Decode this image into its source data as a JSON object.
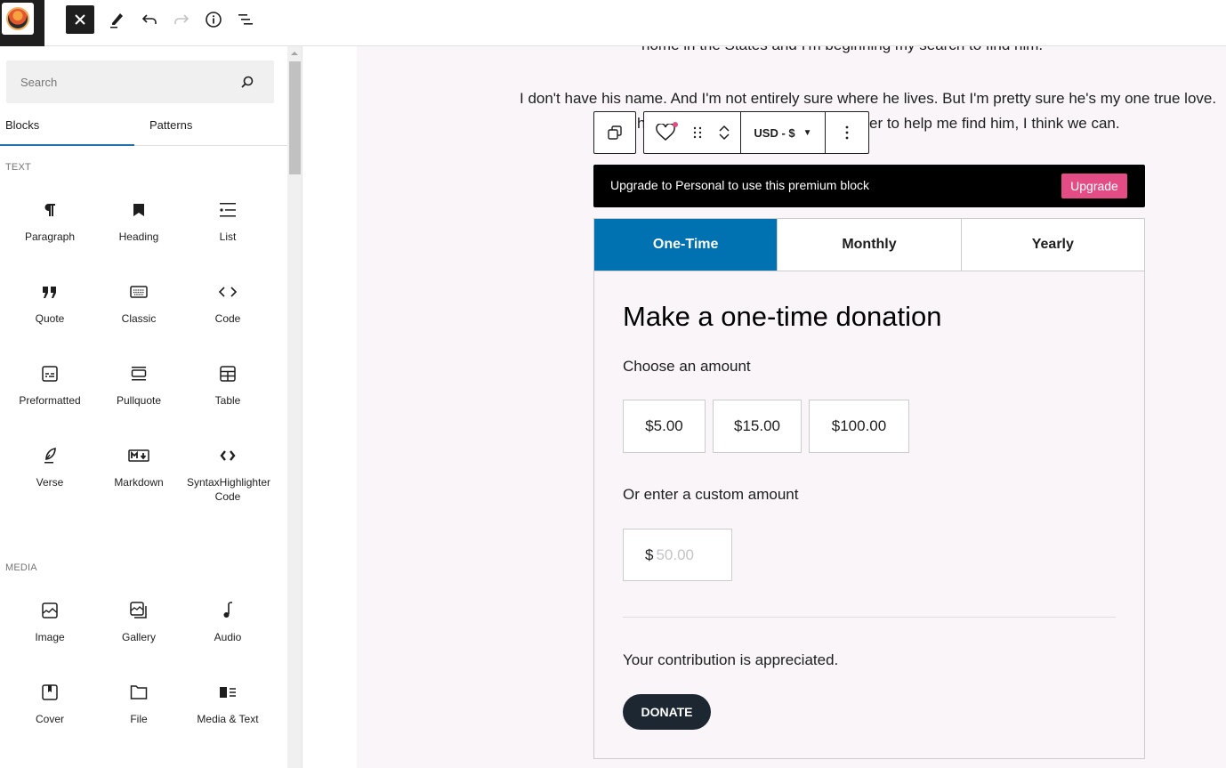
{
  "topbar": {
    "logo_alt": "site-logo",
    "buttons": [
      {
        "name": "close-inserter",
        "icon": "close-icon",
        "glyph": "✕"
      },
      {
        "name": "tools",
        "icon": "pencil-icon"
      },
      {
        "name": "undo",
        "icon": "undo-icon"
      },
      {
        "name": "redo",
        "icon": "redo-icon",
        "disabled": true
      },
      {
        "name": "details",
        "icon": "info-icon"
      },
      {
        "name": "list-view",
        "icon": "list-view-icon"
      }
    ]
  },
  "sidebar": {
    "search_placeholder": "Search",
    "tabs": [
      {
        "label": "Blocks",
        "active": true
      },
      {
        "label": "Patterns",
        "active": false
      }
    ],
    "categories": [
      {
        "title": "TEXT",
        "blocks": [
          {
            "label": "Paragraph",
            "icon": "paragraph-icon"
          },
          {
            "label": "Heading",
            "icon": "heading-icon"
          },
          {
            "label": "List",
            "icon": "list-icon"
          },
          {
            "label": "Quote",
            "icon": "quote-icon"
          },
          {
            "label": "Classic",
            "icon": "keyboard-icon"
          },
          {
            "label": "Code",
            "icon": "code-icon"
          },
          {
            "label": "Preformatted",
            "icon": "preformatted-icon"
          },
          {
            "label": "Pullquote",
            "icon": "pullquote-icon"
          },
          {
            "label": "Table",
            "icon": "table-icon"
          },
          {
            "label": "Verse",
            "icon": "verse-icon"
          },
          {
            "label": "Markdown",
            "icon": "markdown-icon"
          },
          {
            "label": "SyntaxHighlighter Code",
            "icon": "code-bold-icon"
          }
        ]
      },
      {
        "title": "MEDIA",
        "blocks": [
          {
            "label": "Image",
            "icon": "image-icon"
          },
          {
            "label": "Gallery",
            "icon": "gallery-icon"
          },
          {
            "label": "Audio",
            "icon": "audio-icon"
          },
          {
            "label": "Cover",
            "icon": "cover-icon"
          },
          {
            "label": "File",
            "icon": "file-icon"
          },
          {
            "label": "Media & Text",
            "icon": "media-text-icon"
          }
        ]
      }
    ]
  },
  "canvas": {
    "para1_tail": "home in the States and I'm beginning my search to find him.",
    "para2_line1": "I don't have his name. And I'm not entirely sure where he lives. But I'm pretty sure he's my one true love.",
    "para2_line2_left": "h",
    "para2_line2_right": "er to help me find him, I think we can.",
    "block_toolbar": {
      "currency": "USD - $"
    },
    "upgrade_banner": {
      "text": "Upgrade to Personal to use this premium block",
      "button": "Upgrade"
    },
    "donation": {
      "tabs": [
        {
          "label": "One-Time",
          "active": true
        },
        {
          "label": "Monthly",
          "active": false
        },
        {
          "label": "Yearly",
          "active": false
        }
      ],
      "title": "Make a one-time donation",
      "choose_label": "Choose an amount",
      "amounts": [
        "$5.00",
        "$15.00",
        "$100.00"
      ],
      "custom_label": "Or enter a custom amount",
      "custom_currency": "$",
      "custom_placeholder": "50.00",
      "thanks": "Your contribution is appreciated.",
      "donate_button": "DONATE"
    }
  },
  "colors": {
    "accent": "#0071b1",
    "upgrade": "#e34c84",
    "donate": "#1d2731",
    "canvas_bg": "#f9f5f9"
  }
}
